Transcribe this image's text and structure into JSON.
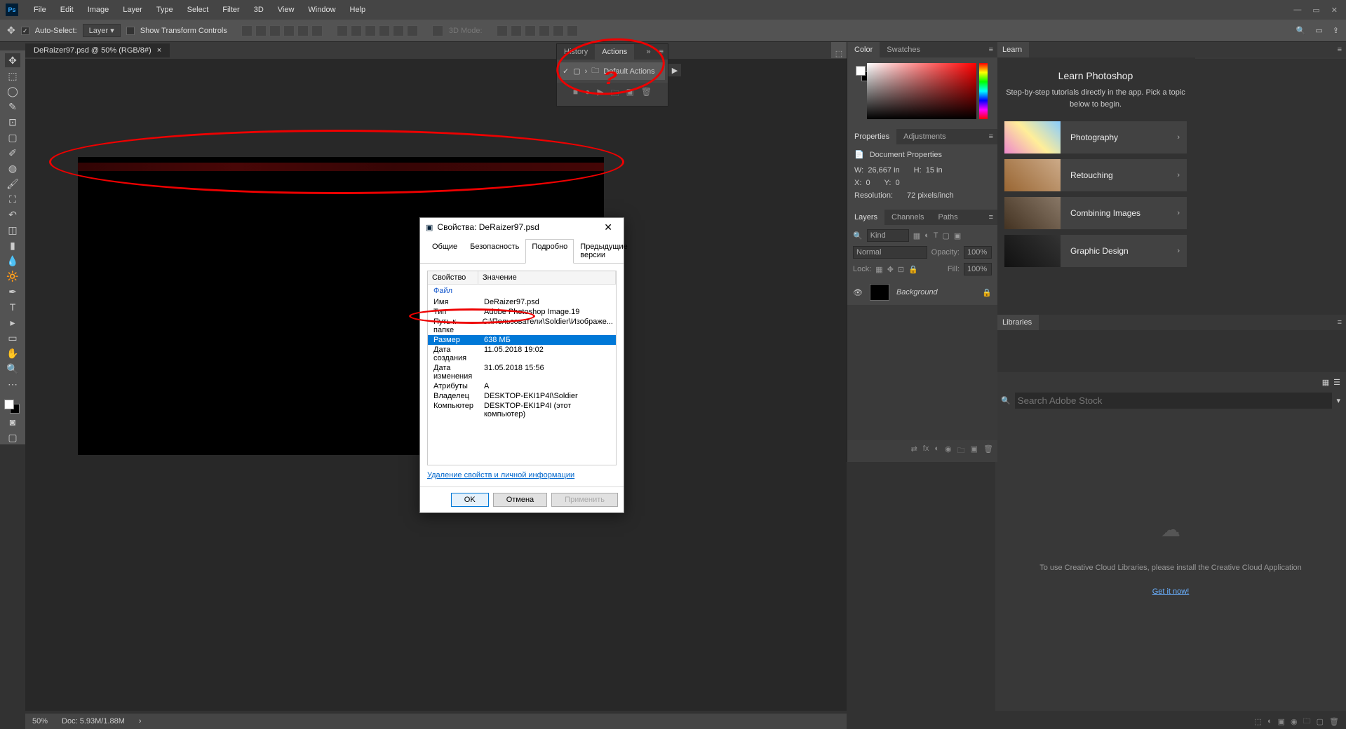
{
  "menu": [
    "File",
    "Edit",
    "Image",
    "Layer",
    "Type",
    "Select",
    "Filter",
    "3D",
    "View",
    "Window",
    "Help"
  ],
  "options": {
    "auto_select": "Auto-Select:",
    "layer": "Layer",
    "show_transform": "Show Transform Controls",
    "model_label": "3D Mode:"
  },
  "doc_tab": {
    "title": "DeRaizer97.psd @ 50% (RGB/8#)",
    "close": "×"
  },
  "actions": {
    "tab_history": "History",
    "tab_actions": "Actions",
    "default": "Default Actions"
  },
  "color_tabs": {
    "color": "Color",
    "swatches": "Swatches"
  },
  "properties": {
    "tab_properties": "Properties",
    "tab_adjustments": "Adjustments",
    "doc_props": "Document Properties",
    "w": "W:",
    "w_val": "26,667 in",
    "h": "H:",
    "h_val": "15 in",
    "x": "X:",
    "x_val": "0",
    "y": "Y:",
    "y_val": "0",
    "res": "Resolution:",
    "res_val": "72 pixels/inch"
  },
  "layers": {
    "tab_layers": "Layers",
    "tab_channels": "Channels",
    "tab_paths": "Paths",
    "kind": "Kind",
    "normal": "Normal",
    "opacity": "Opacity:",
    "opacity_val": "100%",
    "lock": "Lock:",
    "fill": "Fill:",
    "fill_val": "100%",
    "bg_layer": "Background"
  },
  "learn": {
    "tab": "Learn",
    "title": "Learn Photoshop",
    "sub": "Step-by-step tutorials directly in the app. Pick a topic below to begin.",
    "items": [
      "Photography",
      "Retouching",
      "Combining Images",
      "Graphic Design"
    ]
  },
  "libraries": {
    "tab": "Libraries",
    "search_placeholder": "Search Adobe Stock",
    "msg": "To use Creative Cloud Libraries, please install the Creative Cloud Application",
    "link": "Get it now!"
  },
  "dialog": {
    "title": "Свойства: DeRaizer97.psd",
    "tabs": [
      "Общие",
      "Безопасность",
      "Подробно",
      "Предыдущие версии"
    ],
    "col_prop": "Свойство",
    "col_val": "Значение",
    "group": "Файл",
    "rows": [
      {
        "k": "Имя",
        "v": "DeRaizer97.psd"
      },
      {
        "k": "Тип",
        "v": "Adobe Photoshop Image.19"
      },
      {
        "k": "Путь к папке",
        "v": "C:\\Пользователи\\Soldier\\Изображе..."
      },
      {
        "k": "Размер",
        "v": "638 МБ"
      },
      {
        "k": "Дата создания",
        "v": "11.05.2018 19:02"
      },
      {
        "k": "Дата изменения",
        "v": "31.05.2018 15:56"
      },
      {
        "k": "Атрибуты",
        "v": "A"
      },
      {
        "k": "Владелец",
        "v": "DESKTOP-EKI1P4I\\Soldier"
      },
      {
        "k": "Компьютер",
        "v": "DESKTOP-EKI1P4I (этот компьютер)"
      }
    ],
    "link": "Удаление свойств и личной информации",
    "ok": "OK",
    "cancel": "Отмена",
    "apply": "Применить"
  },
  "status": {
    "zoom": "50%",
    "doc": "Doc: 5.93M/1.88M"
  },
  "red_q": "?"
}
